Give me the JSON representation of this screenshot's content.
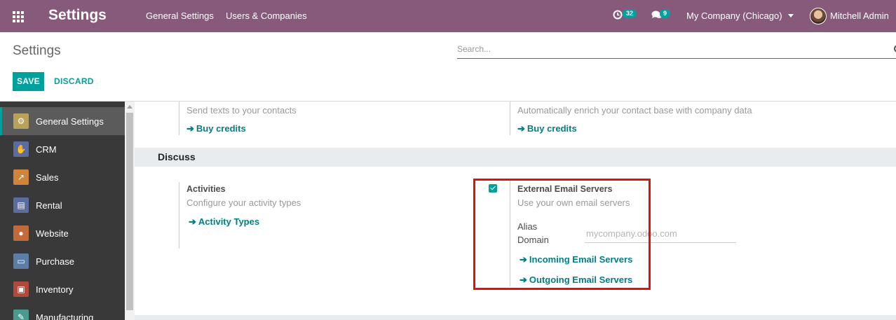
{
  "navbar": {
    "app_title": "Settings",
    "menus": [
      "General Settings",
      "Users & Companies"
    ],
    "activity_count": "32",
    "messages_count": "9",
    "company": "My Company (Chicago)",
    "user_name": "Mitchell Admin",
    "bg_color": "#875a7b"
  },
  "control_panel": {
    "title": "Settings",
    "search_placeholder": "Search...",
    "save_label": "SAVE",
    "discard_label": "DISCARD"
  },
  "sidebar": {
    "items": [
      {
        "label": "General Settings",
        "icon": "gear-icon",
        "color": "#b8a15a",
        "active": true
      },
      {
        "label": "CRM",
        "icon": "handshake-icon",
        "color": "#5b6d9f"
      },
      {
        "label": "Sales",
        "icon": "chart-icon",
        "color": "#d0843b"
      },
      {
        "label": "Rental",
        "icon": "calendar-icon",
        "color": "#5b6d9f"
      },
      {
        "label": "Website",
        "icon": "globe-icon",
        "color": "#c26a3c"
      },
      {
        "label": "Purchase",
        "icon": "card-icon",
        "color": "#5b7da8"
      },
      {
        "label": "Inventory",
        "icon": "box-icon",
        "color": "#b04a3a"
      },
      {
        "label": "Manufacturing",
        "icon": "wrench-icon",
        "color": "#4a9b8f"
      }
    ]
  },
  "content": {
    "top_left": {
      "description": "Send texts to your contacts",
      "link": "Buy credits"
    },
    "top_right": {
      "description": "Automatically enrich your contact base with company data",
      "link": "Buy credits"
    },
    "discuss_section": "Discuss",
    "activities": {
      "title": "Activities",
      "description": "Configure your activity types",
      "link": "Activity Types"
    },
    "external_email": {
      "title": "External Email Servers",
      "description": "Use your own email servers",
      "checked": true,
      "alias_label_1": "Alias",
      "alias_label_2": "Domain",
      "alias_placeholder": "mycompany.odoo.com",
      "incoming_link": "Incoming Email Servers",
      "outgoing_link": "Outgoing Email Servers"
    }
  }
}
